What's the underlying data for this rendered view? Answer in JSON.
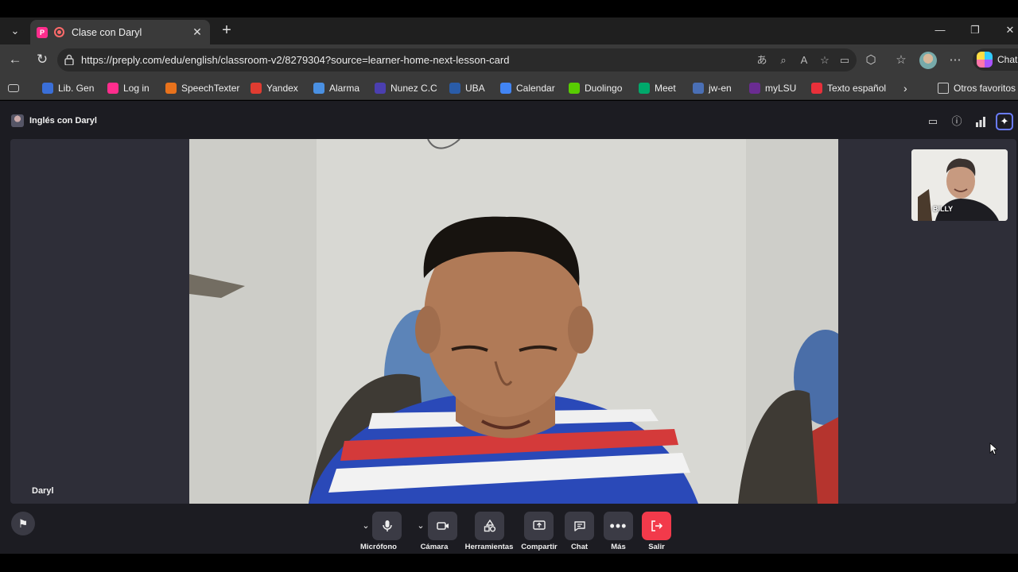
{
  "browser": {
    "tab_title": "Clase con Daryl",
    "url": "https://preply.com/edu/english/classroom-v2/8279304?source=learner-home-next-lesson-card",
    "copilot_label": "Chat"
  },
  "bookmarks": [
    {
      "label": "Lib. Gen",
      "color": "#3a6fd8"
    },
    {
      "label": "Log in",
      "color": "#ff2d8d"
    },
    {
      "label": "SpeechTexter",
      "color": "#e8721c"
    },
    {
      "label": "Yandex",
      "color": "#e03c31"
    },
    {
      "label": "Alarma",
      "color": "#4a90e2"
    },
    {
      "label": "Nunez C.C",
      "color": "#4b3fb0"
    },
    {
      "label": "UBA",
      "color": "#2a5ca8"
    },
    {
      "label": "Calendar",
      "color": "#4285f4"
    },
    {
      "label": "Duolingo",
      "color": "#58cc02"
    },
    {
      "label": "Meet",
      "color": "#00a86b"
    },
    {
      "label": "jw-en",
      "color": "#4a6fb5"
    },
    {
      "label": "myLSU",
      "color": "#6a2c91"
    },
    {
      "label": "Texto español",
      "color": "#e8303a"
    }
  ],
  "bookmarks_more": "Otros favoritos",
  "classroom": {
    "room_title": "Inglés con Daryl",
    "main_speaker": "Daryl",
    "thumbnail_name": "BILLY"
  },
  "controls": {
    "microphone": "Micrófono",
    "camera": "Cámara",
    "tools": "Herramientas",
    "share": "Compartir",
    "chat": "Chat",
    "more": "Más",
    "exit": "Salir"
  },
  "colors": {
    "exit": "#f23a4b",
    "accent": "#6a7cff",
    "brand": "#ff2d8d"
  }
}
